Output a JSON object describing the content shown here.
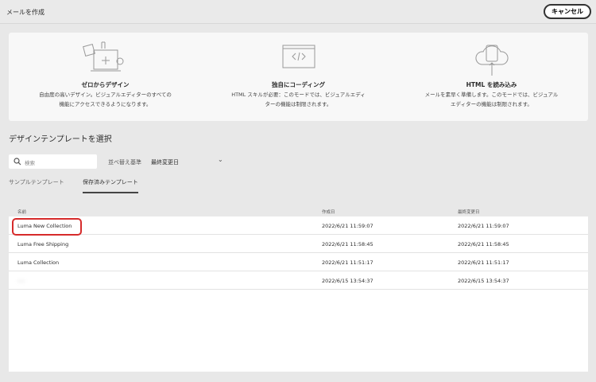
{
  "header": {
    "title": "メールを作成",
    "cancel_label": "キャンセル"
  },
  "options": [
    {
      "title": "ゼロからデザイン",
      "desc": "自由度の高いデザイン。ビジュアルエディターのすべての機能にアクセスできるようになります。"
    },
    {
      "title": "独自にコーディング",
      "desc": "HTML スキルが必要：このモードでは、ビジュアルエディターの機能は制限されます。"
    },
    {
      "title": "HTML を読み込み",
      "desc": "メールを素早く準備します。このモードでは、ビジュアルエディターの機能は制限されます。"
    }
  ],
  "section_title": "デザインテンプレートを選択",
  "search": {
    "placeholder": "検索"
  },
  "sort": {
    "label": "並べ替え基準",
    "value": "最終変更日"
  },
  "tabs": [
    {
      "label": "サンプルテンプレート"
    },
    {
      "label": "保存済みテンプレート"
    }
  ],
  "table": {
    "columns": [
      "名前",
      "作成日",
      "最終変更日"
    ],
    "rows": [
      {
        "name": "Luma New Collection",
        "created": "2022/6/21 11:59:07",
        "modified": "2022/6/21 11:59:07"
      },
      {
        "name": "Luma Free Shipping",
        "created": "2022/6/21 11:58:45",
        "modified": "2022/6/21 11:58:45"
      },
      {
        "name": "Luma Collection",
        "created": "2022/6/21 11:51:17",
        "modified": "2022/6/21 11:51:17"
      },
      {
        "name": "----",
        "created": "2022/6/15 13:54:37",
        "modified": "2022/6/15 13:54:37"
      }
    ]
  }
}
